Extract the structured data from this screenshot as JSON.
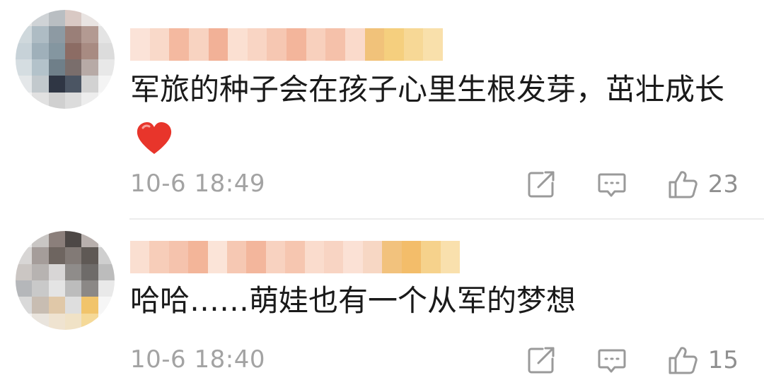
{
  "comments": [
    {
      "text": "军旅的种子会在孩子心里生根发芽，茁壮成长",
      "has_heart_emoji": true,
      "timestamp": "10-6 18:49",
      "likes": "23",
      "icons": [
        "avatar-blurred",
        "username-blurred",
        "share-icon",
        "reply-icon",
        "like-icon",
        "heart-emoji"
      ]
    },
    {
      "text": "哈哈……萌娃也有一个从军的梦想",
      "has_heart_emoji": false,
      "timestamp": "10-6 18:40",
      "likes": "15",
      "icons": [
        "avatar-blurred",
        "username-blurred",
        "share-icon",
        "reply-icon",
        "like-icon"
      ]
    }
  ],
  "colors": {
    "text": "#1a1a1a",
    "meta": "#a3a3a3",
    "icon": "#9a9a9a",
    "heart": "#e8352b",
    "divider": "#ececec"
  }
}
